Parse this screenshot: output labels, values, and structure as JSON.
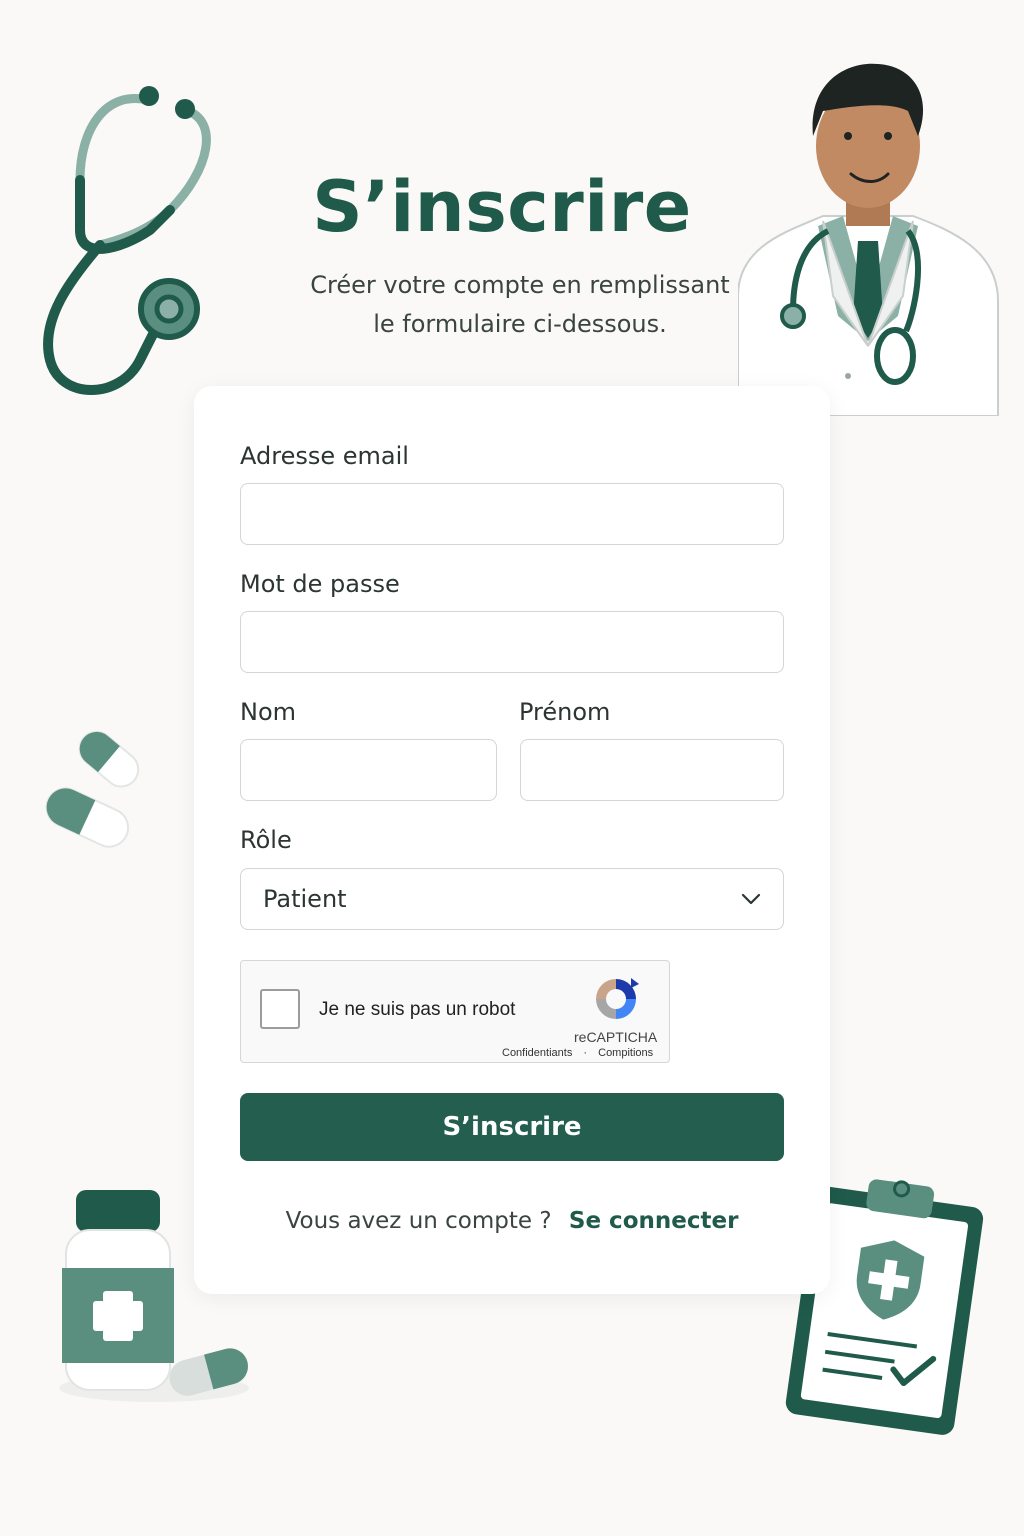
{
  "header": {
    "title": "S’inscrire",
    "subtitle_line1": "Créer votre compte en remplissant",
    "subtitle_line2": "le formulaire ci-dessous."
  },
  "form": {
    "email": {
      "label": "Adresse email",
      "value": "",
      "placeholder": ""
    },
    "password": {
      "label": "Mot de passe",
      "value": "",
      "placeholder": ""
    },
    "last_name": {
      "label": "Nom",
      "value": "",
      "placeholder": ""
    },
    "first_name": {
      "label": "Prénom",
      "value": "",
      "placeholder": ""
    },
    "role": {
      "label": "Rôle",
      "selected": "Patient"
    },
    "captcha": {
      "label": "Je ne suis pas un  robot",
      "brand": "reCAPTICHA",
      "link_privacy": "Confidentiants",
      "separator": "·",
      "link_terms": "Compitions",
      "checked": false
    },
    "submit_label": "S’inscrire"
  },
  "footer": {
    "prompt": "Vous avez un compte ?",
    "link_label": "Se connecter"
  },
  "colors": {
    "brand": "#235e4e",
    "brand_light": "#5a8f80",
    "background": "#faf9f7"
  },
  "decorations": [
    "stethoscope-icon",
    "doctor-illustration",
    "pills-icon",
    "medicine-bottle-icon",
    "medical-clipboard-icon"
  ]
}
